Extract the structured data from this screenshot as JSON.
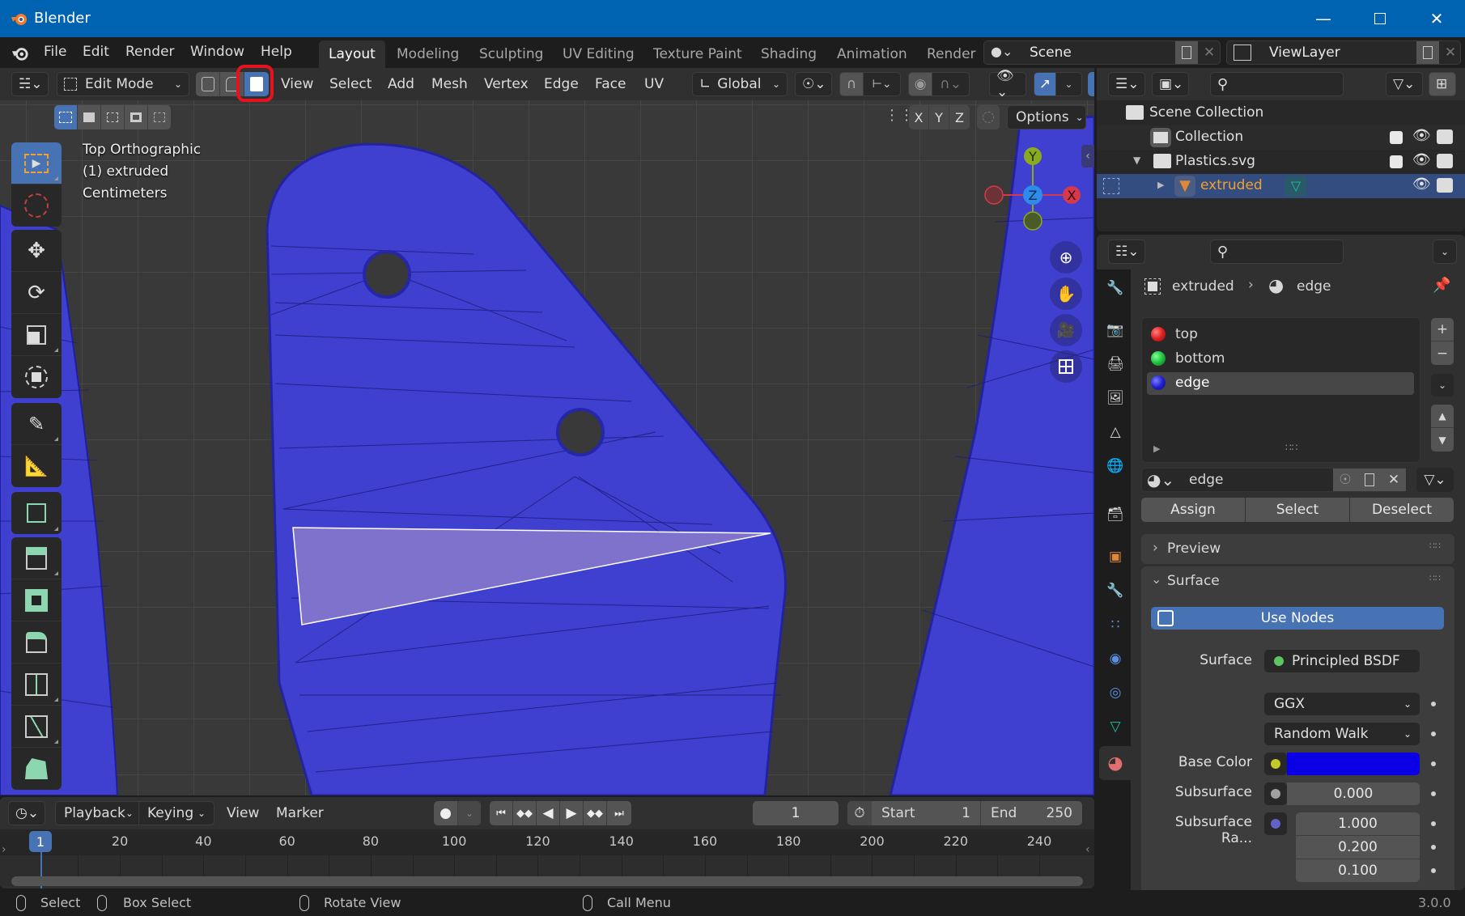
{
  "window": {
    "title": "Blender",
    "controls": [
      "minimize",
      "maximize",
      "close"
    ]
  },
  "menubar": {
    "items": [
      "File",
      "Edit",
      "Render",
      "Window",
      "Help"
    ],
    "workspaces": [
      "Layout",
      "Modeling",
      "Sculpting",
      "UV Editing",
      "Texture Paint",
      "Shading",
      "Animation",
      "Render"
    ],
    "active_workspace": "Layout",
    "scene": "Scene",
    "view_layer": "ViewLayer"
  },
  "viewport_header": {
    "mode": "Edit Mode",
    "select_modes": [
      "vertex",
      "edge",
      "face"
    ],
    "active_select_mode": "face",
    "menus": [
      "View",
      "Select",
      "Add",
      "Mesh",
      "Vertex",
      "Edge",
      "Face",
      "UV"
    ],
    "transform_orientation": "Global",
    "mirror_axes": [
      "X",
      "Y",
      "Z"
    ],
    "options_label": "Options"
  },
  "viewport": {
    "view_name": "Top Orthographic",
    "object_info": "(1) extruded",
    "units": "Centimeters",
    "gizmo_axes": {
      "y": "Y",
      "z": "Z",
      "x": "X"
    },
    "mesh_color": "#3f3fd0",
    "selected_face_color": "#7f72cc"
  },
  "outliner": {
    "rows": [
      {
        "label": "Scene Collection",
        "type": "scene-collection"
      },
      {
        "label": "Collection",
        "type": "collection",
        "checked": true
      },
      {
        "label": "Plastics.svg",
        "type": "collection",
        "checked": true,
        "expanded": true
      },
      {
        "label": "extruded",
        "type": "mesh-object",
        "selected": true
      }
    ]
  },
  "properties": {
    "breadcrumb": {
      "object": "extruded",
      "material": "edge"
    },
    "material_slots": [
      {
        "name": "top",
        "color": "#e02020"
      },
      {
        "name": "bottom",
        "color": "#20c040"
      },
      {
        "name": "edge",
        "color": "#2020d0",
        "active": true
      }
    ],
    "material_name": "edge",
    "slot_buttons": {
      "assign": "Assign",
      "select": "Select",
      "deselect": "Deselect"
    },
    "panels": {
      "preview": "Preview",
      "surface": "Surface"
    },
    "use_nodes_label": "Use Nodes",
    "surface": {
      "label": "Surface",
      "shader": "Principled BSDF",
      "distribution": "GGX",
      "subsurface_method": "Random Walk",
      "base_color_label": "Base Color",
      "base_color": "#0a00e6",
      "subsurface_label": "Subsurface",
      "subsurface_value": "0.000",
      "subsurface_radius_label": "Subsurface Ra...",
      "subsurface_radius": [
        "1.000",
        "0.200",
        "0.100"
      ]
    }
  },
  "timeline": {
    "menus": [
      "Playback",
      "Keying",
      "View",
      "Marker"
    ],
    "current_frame": "1",
    "start_label": "Start",
    "start": "1",
    "end_label": "End",
    "end": "250",
    "ticks": [
      "20",
      "40",
      "60",
      "80",
      "100",
      "120",
      "140",
      "160",
      "180",
      "200",
      "220",
      "240"
    ],
    "playhead_label": "1"
  },
  "statusbar": {
    "items": [
      "Select",
      "Box Select",
      "Rotate View",
      "Call Menu"
    ],
    "version": "3.0.0"
  }
}
